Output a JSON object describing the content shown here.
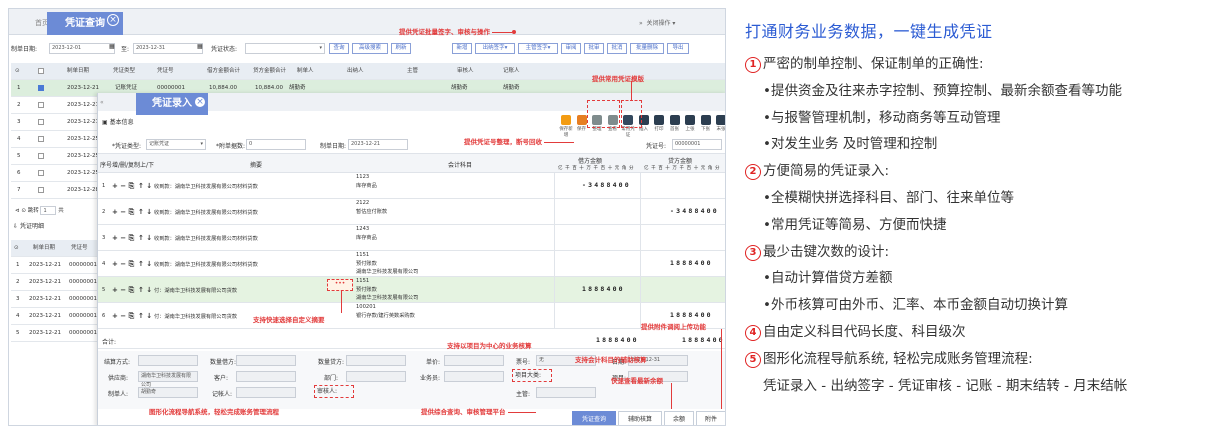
{
  "tabs": {
    "home": "首页",
    "voucher_query": "凭证查询",
    "close_ops": "关闭操作"
  },
  "filter": {
    "date_label": "制单日期:",
    "date_from": "2023-12-01",
    "to": "至:",
    "date_to": "2023-12-31",
    "status_label": "凭证状态:",
    "btn_query": "查询",
    "btn_advanced": "高级搜索",
    "btn_refresh": "刷新",
    "btn_new": "新增",
    "btn_cashier": "出纳签字",
    "btn_supervisor": "主管签字",
    "btn_review": "审阅",
    "btn_approve": "批审",
    "btn_reverse": "批消",
    "btn_batch_delete": "批量删除",
    "btn_export": "导出"
  },
  "grid1": {
    "headers": [
      "",
      "制单日期",
      "凭证类型",
      "凭证号",
      "借方金额合计",
      "贷方金额合计",
      "制单人",
      "出纳人",
      "主管",
      "审核人",
      "记账人"
    ],
    "rows": [
      {
        "no": "1",
        "date": "2023-12-21",
        "type": "记账凭证",
        "code": "00000001",
        "debit": "10,884.00",
        "credit": "10,884.00",
        "maker": "胡勤奇",
        "auditor": "胡勤奇",
        "booker": "胡勤奇"
      },
      {
        "no": "2",
        "date": "2023-12-21"
      },
      {
        "no": "3",
        "date": "2023-12-21"
      },
      {
        "no": "4",
        "date": "2023-12-25"
      },
      {
        "no": "5",
        "date": "2023-12-25"
      },
      {
        "no": "6",
        "date": "2023-12-25"
      },
      {
        "no": "7",
        "date": "2023-12-28"
      }
    ],
    "pager": {
      "jump": "跳转",
      "page": "1",
      "total": "共"
    },
    "detail_title": "凭证明细"
  },
  "grid2": {
    "headers": [
      "",
      "制单日期",
      "凭证号"
    ],
    "rows": [
      {
        "no": "1",
        "date": "2023-12-21",
        "code": "00000001"
      },
      {
        "no": "2",
        "date": "2023-12-21",
        "code": "00000001"
      },
      {
        "no": "3",
        "date": "2023-12-21",
        "code": "00000001"
      },
      {
        "no": "4",
        "date": "2023-12-21",
        "code": "00000001"
      },
      {
        "no": "5",
        "date": "2023-12-21",
        "code": "00000001"
      }
    ]
  },
  "entry": {
    "title": "凭证录入",
    "basic": "基本信息",
    "type_label": "*凭证类型:",
    "type_value": "记账凭证",
    "att_label": "*附单据数:",
    "att_value": "0",
    "date_label": "制单日期:",
    "date_value": "2023-12-21",
    "code_label": "凭证号:",
    "code_value": "00000001",
    "toolbar": [
      "保存新增",
      "保存",
      "整理",
      "查看",
      "常用凭证",
      "插入",
      "打印",
      "首张",
      "上张",
      "下张",
      "末张"
    ],
    "col_no": "序号",
    "col_ops": "增/删/复制",
    "col_move": "上/下",
    "col_summary": "摘要",
    "col_account": "会计科目",
    "col_debit": "借方金额",
    "col_credit": "贷方金额",
    "digits": "亿千百十万千百十元角分",
    "lines": [
      {
        "no": "1",
        "summary": "收到款：湖南华卫科技发展有限公司材料贷款",
        "acct1": "1123",
        "acct2": "库存商品",
        "debit": "-3488400",
        "credit": ""
      },
      {
        "no": "2",
        "summary": "收到款：湖南华卫科技发展有限公司材料贷款",
        "acct1": "2122",
        "acct2": "暂估应付账款",
        "debit": "",
        "credit": "-3488400"
      },
      {
        "no": "3",
        "summary": "收到款：湖南华卫科技发展有限公司材料贷款",
        "acct1": "1243",
        "acct2": "库存商品",
        "debit": "",
        "credit": ""
      },
      {
        "no": "4",
        "summary": "收到款：湖南华卫科技发展有限公司材料贷款",
        "acct1": "1151",
        "acct2": "预付账款",
        "acct3": "湖南华卫科技发展有限公司",
        "debit": "",
        "credit": "1888400"
      },
      {
        "no": "5",
        "summary": "付：湖南华卫科技发展有限公司货款",
        "acct1": "1151",
        "acct2": "预付账款",
        "acct3": "湖南华卫科技发展有限公司",
        "debit": "1888400",
        "credit": ""
      },
      {
        "no": "6",
        "summary": "付：湖南华卫科技发展有限公司货款",
        "acct1": "100201",
        "acct2": "银行存款/建行英数采购款",
        "debit": "",
        "credit": "1888400"
      }
    ],
    "total_label": "合计:",
    "total_debit": "1888400",
    "total_credit": "1888400",
    "aux": {
      "settle": "结算方式:",
      "qty": "数量借方:",
      "qty_credit": "数量贷方:",
      "price": "单价:",
      "bill_no": "票号:",
      "bill_val": "无",
      "date": "日期:",
      "date_val": "2023-12-31",
      "supplier": "供应商:",
      "supplier_val": "湖南华卫科技发展有限公司",
      "customer": "客户:",
      "dept": "部门:",
      "staff": "业务员:",
      "project": "项目大类:",
      "project2": "项目:",
      "maker": "制单人:",
      "maker_val": "胡勤奇",
      "booker": "记帐人:",
      "auditor": "审核人:",
      "supervisor": "主管:"
    },
    "footer": [
      "凭证查询",
      "辅助核算",
      "余额",
      "附件"
    ]
  },
  "annotations": {
    "a1": "提供凭证批量签字、审核与操作",
    "a2": "提供常用凭证模版",
    "a3": "提供凭证号整理，断号回收",
    "a4": "支持快速选择自定义摘要",
    "a5": "支持以项目为中心的业务核算",
    "a6": "支持会计科目的辅助核算",
    "a7": "提供附件调阅上传功能",
    "a8": "快速查看最新余额",
    "a9": "图形化流程导航系统，轻松完成账务管理流程",
    "a10": "提供综合查询、审核管理平台"
  },
  "right": {
    "title": "打通财务业务数据，一键生成凭证",
    "items": [
      {
        "num": "1",
        "text": "严密的制单控制、保证制单的正确性:"
      },
      {
        "num": "",
        "text": "•提供资金及往来赤字控制、预算控制、最新余额查看等功能"
      },
      {
        "num": "",
        "text": "•与报警管理机制，移动商务等互动管理"
      },
      {
        "num": "",
        "text": "•对发生业务 及时管理和控制"
      },
      {
        "num": "2",
        "text": "方便简易的凭证录入:"
      },
      {
        "num": "",
        "text": "•全模糊快拼选择科目、部门、往来单位等"
      },
      {
        "num": "",
        "text": "•常用凭证等简易、方便而快捷"
      },
      {
        "num": "3",
        "text": "最少击键次数的设计:"
      },
      {
        "num": "",
        "text": "•自动计算借贷方差额"
      },
      {
        "num": "",
        "text": "•外币核算可由外币、汇率、本币金额自动切换计算"
      },
      {
        "num": "4",
        "text": "自由定义科目代码长度、科目级次"
      },
      {
        "num": "5",
        "text": "图形化流程导航系统, 轻松完成账务管理流程:"
      },
      {
        "num": "",
        "text": "凭证录入 - 出纳签字 - 凭证审核 - 记账 - 期末结转 - 月末结帐"
      }
    ]
  },
  "colors": {
    "accent": "#6c8bd6",
    "annotation": "#e23b3b",
    "title": "#2b5bd3"
  }
}
